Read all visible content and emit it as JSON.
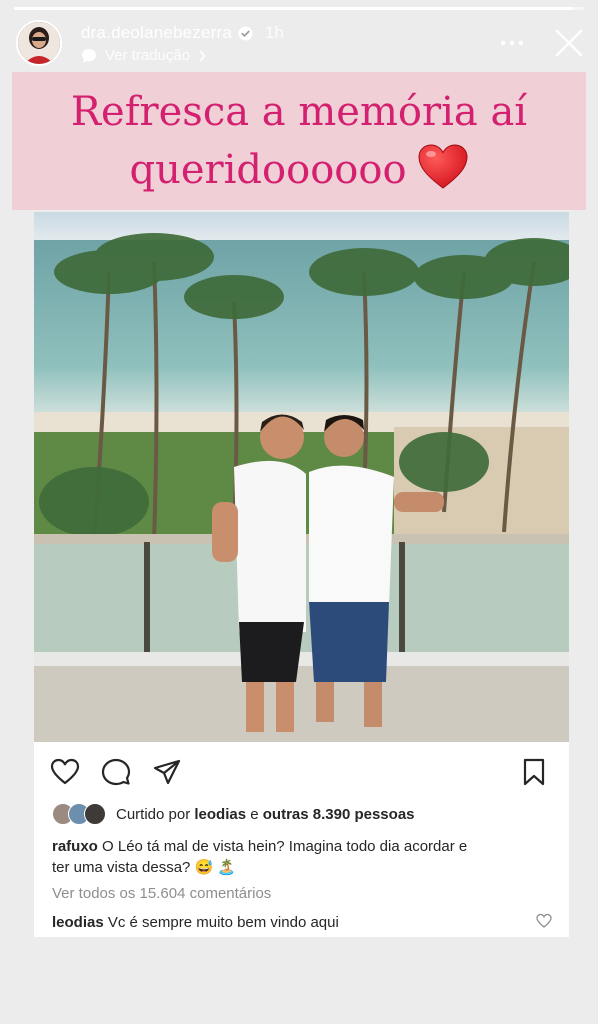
{
  "story": {
    "progress": 0.98
  },
  "header": {
    "username": "dra.deolanebezerra",
    "time": "1h",
    "translate_label": "Ver tradução",
    "more_icon": "more-horizontal-icon",
    "close_icon": "close-icon"
  },
  "caption": {
    "line1": "Refresca a memória aí",
    "line2": "queridoooooo",
    "emoji": "❤️",
    "text_color": "#d3206f",
    "background": "#f0cfd7"
  },
  "post": {
    "likes": {
      "prefix": "Curtido por",
      "user": "leodias",
      "connector": "e",
      "others": "outras 8.390 pessoas"
    },
    "comment1": {
      "user": "rafuxo",
      "line1": "O Léo tá mal de vista hein? Imagina todo dia acordar e",
      "line2": "ter uma vista dessa? 😅 🏝️"
    },
    "view_all": "Ver todos os 15.604 comentários",
    "comment2": {
      "user": "leodias",
      "text": "Vc é sempre muito bem vindo aqui"
    },
    "icons": [
      "heart-icon",
      "comment-icon",
      "share-icon",
      "bookmark-icon"
    ]
  }
}
